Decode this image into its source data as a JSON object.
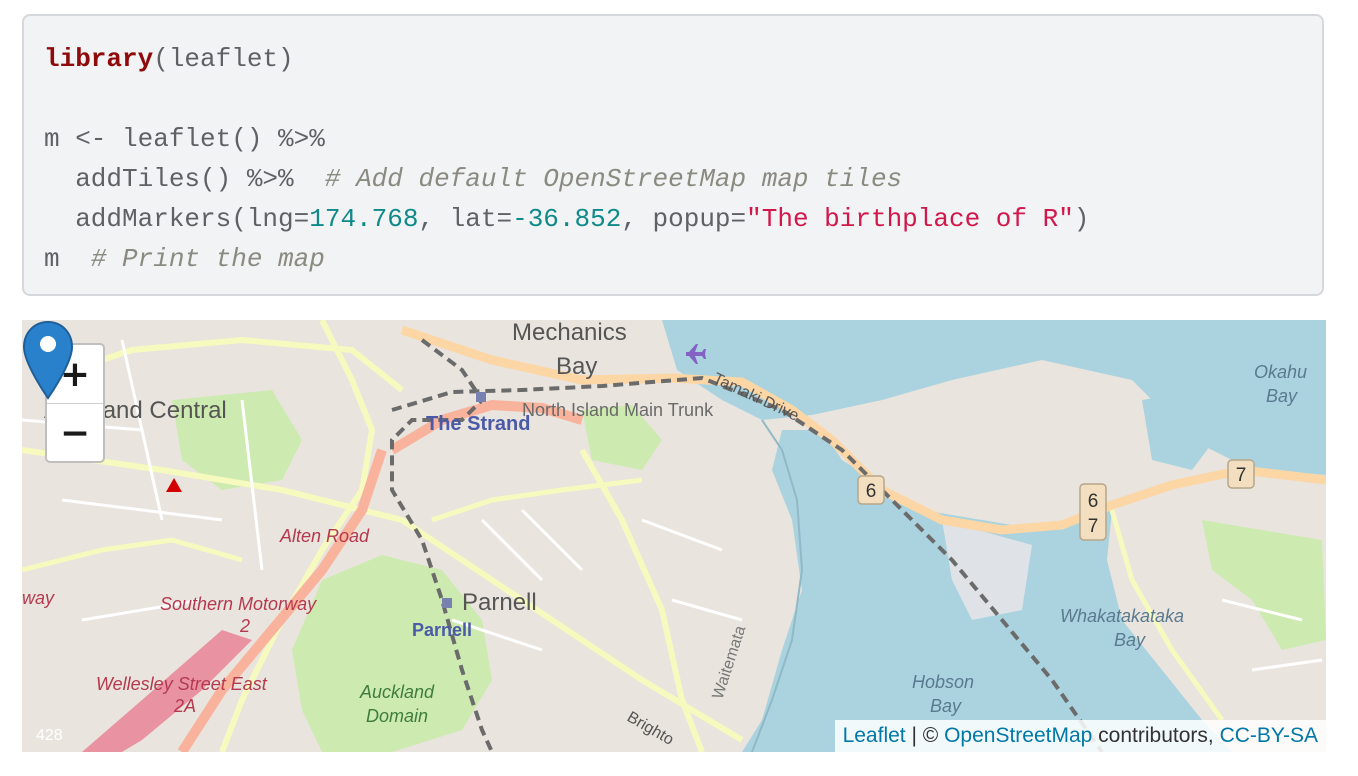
{
  "code": {
    "line1": {
      "fn": "library",
      "rest": "(leaflet)"
    },
    "line2": {
      "text": "m <- leaflet() %>%"
    },
    "line3": {
      "code": "  addTiles() %>%  ",
      "comment": "# Add default OpenStreetMap map tiles"
    },
    "line4": {
      "pre": "  addMarkers(lng=",
      "lng": "174.768",
      "mid": ", lat=",
      "lat": "-36.852",
      "mid2": ", popup=",
      "popup": "\"The birthplace of R\"",
      "post": ")"
    },
    "line5": {
      "code": "m  ",
      "comment": "# Print the map"
    }
  },
  "map": {
    "zoom_in": "+",
    "zoom_out": "−",
    "labels": {
      "mechanics": "Mechanics",
      "bay": "Bay",
      "auckland_central": "Auckland Central",
      "the_strand": "The Strand",
      "north_island": "North Island Main Trunk",
      "tamaki_drive": "Tamaki Drive",
      "okahu": "Okahu",
      "okahu_bay": "Bay",
      "alten_road": "Alten Road",
      "parnell": "Parnell",
      "parnell_station": "Parnell",
      "southern_motorway": "Southern Motorway",
      "motorway_2": "2",
      "wellesley": "Wellesley Street East",
      "wellesley_2a": "2A",
      "auckland_domain_1": "Auckland",
      "auckland_domain_2": "Domain",
      "waitemata": "Waitemata",
      "brighton": "Brighto",
      "hobson": "Hobson",
      "hobson_bay": "Bay",
      "whakatakataka": "Whakatakataka",
      "whakatakataka_bay": "Bay",
      "way": "way",
      "addr": "428",
      "shield_6a": "6",
      "shield_6b": "6",
      "shield_7a": "7",
      "shield_7b": "7"
    },
    "attribution": {
      "leaflet": "Leaflet",
      "sep": " | © ",
      "osm": "OpenStreetMap",
      "contrib": " contributors, ",
      "license": "CC-BY-SA"
    },
    "colors": {
      "water": "#aad3df",
      "land": "#e9e4dd",
      "park": "#cdebb0",
      "motorway": "#e892a2",
      "trunk": "#f9b29c",
      "primary": "#fcd6a4",
      "secondary": "#f7fabf",
      "marker": "#2a81cb"
    }
  }
}
